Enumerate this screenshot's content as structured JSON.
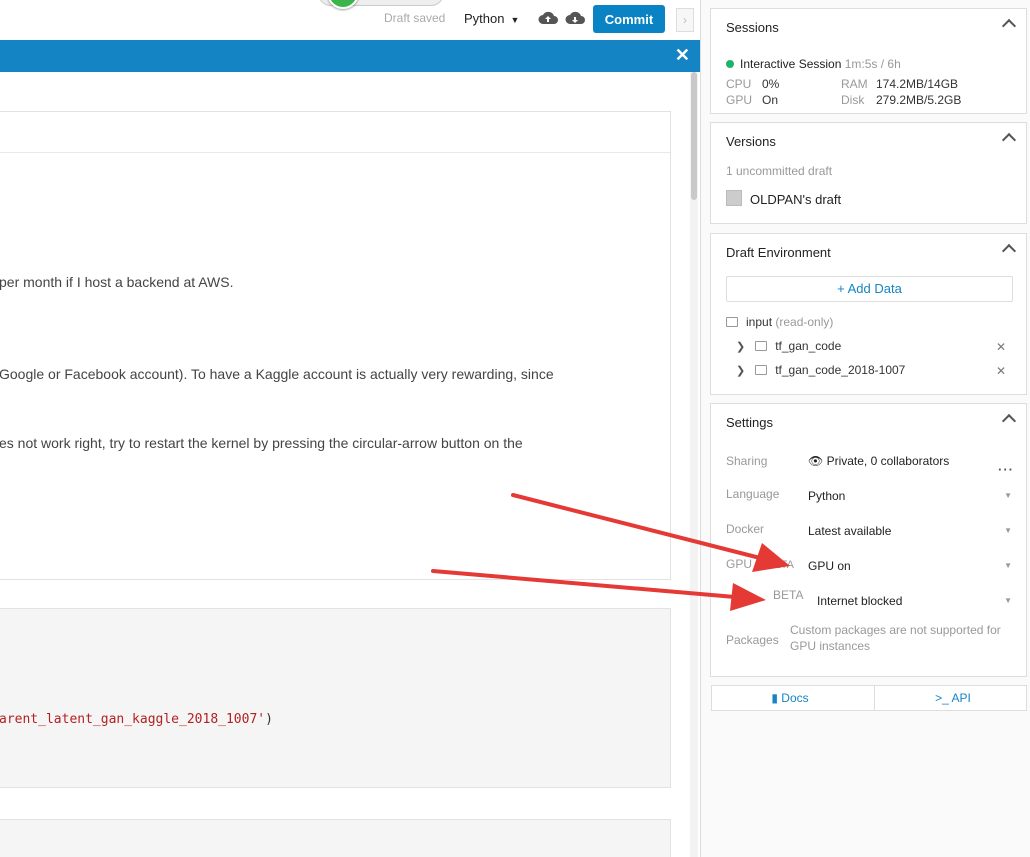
{
  "toolbar": {
    "draft_saved": "Draft saved",
    "language": "Python",
    "commit": "Commit"
  },
  "notebook": {
    "md_lines": [
      "per month if I host a backend at AWS.",
      "Google or Facebook account). To have a Kaggle account is actually very rewarding, since",
      "es not work right, try to restart the kernel by pressing the circular-arrow button on the"
    ],
    "code_text": "arent_latent_gan_kaggle_2018_1007'",
    "code_paren": ")"
  },
  "sessions": {
    "title": "Sessions",
    "status_label": "Interactive Session",
    "elapsed": "1m:5s / 6h",
    "cpu_label": "CPU",
    "cpu_value": "0%",
    "ram_label": "RAM",
    "ram_value": "174.2MB/14GB",
    "gpu_label": "GPU",
    "gpu_value": "On",
    "disk_label": "Disk",
    "disk_value": "279.2MB/5.2GB",
    "status_color": "#20b26b"
  },
  "versions": {
    "title": "Versions",
    "uncommitted": "1 uncommitted draft",
    "draft_name": "OLDPAN's draft"
  },
  "environment": {
    "title": "Draft Environment",
    "add_data": "+ Add Data",
    "input_label": "input",
    "input_note": "(read-only)",
    "datasets": [
      "tf_gan_code",
      "tf_gan_code_2018-1007"
    ]
  },
  "settings": {
    "title": "Settings",
    "sharing_label": "Sharing",
    "sharing_value": "Private, 0 collaborators",
    "language_label": "Language",
    "language_value": "Python",
    "docker_label": "Docker",
    "docker_value": "Latest available",
    "gpu_label": "GPU",
    "gpu_beta": "BETA",
    "gpu_value": "GPU on",
    "internet_beta": "BETA",
    "internet_value": "Internet blocked",
    "packages_label": "Packages",
    "packages_note": "Custom packages are not supported for GPU instances"
  },
  "footer": {
    "docs": "Docs",
    "api": "API"
  },
  "colors": {
    "accent": "#1584c5",
    "commit": "#0a83c5",
    "annotation_arrow": "#e53935"
  }
}
